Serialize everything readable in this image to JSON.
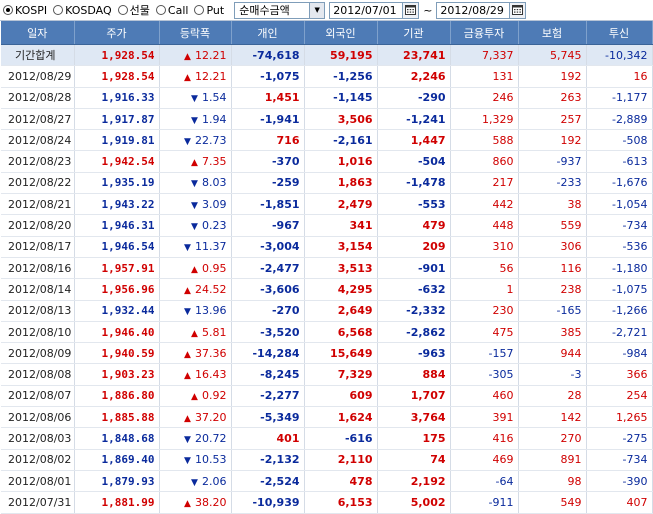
{
  "toolbar": {
    "market_options": [
      {
        "label": "KOSPI",
        "selected": true
      },
      {
        "label": "KOSDAQ",
        "selected": false
      },
      {
        "label": "선물",
        "selected": false
      },
      {
        "label": "Call",
        "selected": false
      },
      {
        "label": "Put",
        "selected": false
      }
    ],
    "metric_select": "순매수금액",
    "start_date": "2012/07/01",
    "separator": "~",
    "end_date": "2012/08/29"
  },
  "columns": [
    "일자",
    "주가",
    "등락폭",
    "개인",
    "외국인",
    "기관",
    "금융투자",
    "보험",
    "투신"
  ],
  "rows": [
    {
      "date": "기간합계",
      "price": "1,928.54",
      "dir": "up",
      "change": "12.21",
      "indiv": "-74,618",
      "foreign": "59,195",
      "inst": "23,741",
      "fin": "7,337",
      "ins": "5,745",
      "trust": "-10,342",
      "sum": true
    },
    {
      "date": "2012/08/29",
      "price": "1,928.54",
      "dir": "up",
      "change": "12.21",
      "indiv": "-1,075",
      "foreign": "-1,256",
      "inst": "2,246",
      "fin": "131",
      "ins": "192",
      "trust": "16"
    },
    {
      "date": "2012/08/28",
      "price": "1,916.33",
      "dir": "dn",
      "change": "1.54",
      "indiv": "1,451",
      "foreign": "-1,145",
      "inst": "-290",
      "fin": "246",
      "ins": "263",
      "trust": "-1,177"
    },
    {
      "date": "2012/08/27",
      "price": "1,917.87",
      "dir": "dn",
      "change": "1.94",
      "indiv": "-1,941",
      "foreign": "3,506",
      "inst": "-1,241",
      "fin": "1,329",
      "ins": "257",
      "trust": "-2,889"
    },
    {
      "date": "2012/08/24",
      "price": "1,919.81",
      "dir": "dn",
      "change": "22.73",
      "indiv": "716",
      "foreign": "-2,161",
      "inst": "1,447",
      "fin": "588",
      "ins": "192",
      "trust": "-508"
    },
    {
      "date": "2012/08/23",
      "price": "1,942.54",
      "dir": "up",
      "change": "7.35",
      "indiv": "-370",
      "foreign": "1,016",
      "inst": "-504",
      "fin": "860",
      "ins": "-937",
      "trust": "-613"
    },
    {
      "date": "2012/08/22",
      "price": "1,935.19",
      "dir": "dn",
      "change": "8.03",
      "indiv": "-259",
      "foreign": "1,863",
      "inst": "-1,478",
      "fin": "217",
      "ins": "-233",
      "trust": "-1,676"
    },
    {
      "date": "2012/08/21",
      "price": "1,943.22",
      "dir": "dn",
      "change": "3.09",
      "indiv": "-1,851",
      "foreign": "2,479",
      "inst": "-553",
      "fin": "442",
      "ins": "38",
      "trust": "-1,054"
    },
    {
      "date": "2012/08/20",
      "price": "1,946.31",
      "dir": "dn",
      "change": "0.23",
      "indiv": "-967",
      "foreign": "341",
      "inst": "479",
      "fin": "448",
      "ins": "559",
      "trust": "-734"
    },
    {
      "date": "2012/08/17",
      "price": "1,946.54",
      "dir": "dn",
      "change": "11.37",
      "indiv": "-3,004",
      "foreign": "3,154",
      "inst": "209",
      "fin": "310",
      "ins": "306",
      "trust": "-536"
    },
    {
      "date": "2012/08/16",
      "price": "1,957.91",
      "dir": "up",
      "change": "0.95",
      "indiv": "-2,477",
      "foreign": "3,513",
      "inst": "-901",
      "fin": "56",
      "ins": "116",
      "trust": "-1,180"
    },
    {
      "date": "2012/08/14",
      "price": "1,956.96",
      "dir": "up",
      "change": "24.52",
      "indiv": "-3,606",
      "foreign": "4,295",
      "inst": "-632",
      "fin": "1",
      "ins": "238",
      "trust": "-1,075"
    },
    {
      "date": "2012/08/13",
      "price": "1,932.44",
      "dir": "dn",
      "change": "13.96",
      "indiv": "-270",
      "foreign": "2,649",
      "inst": "-2,332",
      "fin": "230",
      "ins": "-165",
      "trust": "-1,266"
    },
    {
      "date": "2012/08/10",
      "price": "1,946.40",
      "dir": "up",
      "change": "5.81",
      "indiv": "-3,520",
      "foreign": "6,568",
      "inst": "-2,862",
      "fin": "475",
      "ins": "385",
      "trust": "-2,721"
    },
    {
      "date": "2012/08/09",
      "price": "1,940.59",
      "dir": "up",
      "change": "37.36",
      "indiv": "-14,284",
      "foreign": "15,649",
      "inst": "-963",
      "fin": "-157",
      "ins": "944",
      "trust": "-984"
    },
    {
      "date": "2012/08/08",
      "price": "1,903.23",
      "dir": "up",
      "change": "16.43",
      "indiv": "-8,245",
      "foreign": "7,329",
      "inst": "884",
      "fin": "-305",
      "ins": "-3",
      "trust": "366"
    },
    {
      "date": "2012/08/07",
      "price": "1,886.80",
      "dir": "up",
      "change": "0.92",
      "indiv": "-2,277",
      "foreign": "609",
      "inst": "1,707",
      "fin": "460",
      "ins": "28",
      "trust": "254"
    },
    {
      "date": "2012/08/06",
      "price": "1,885.88",
      "dir": "up",
      "change": "37.20",
      "indiv": "-5,349",
      "foreign": "1,624",
      "inst": "3,764",
      "fin": "391",
      "ins": "142",
      "trust": "1,265"
    },
    {
      "date": "2012/08/03",
      "price": "1,848.68",
      "dir": "dn",
      "change": "20.72",
      "indiv": "401",
      "foreign": "-616",
      "inst": "175",
      "fin": "416",
      "ins": "270",
      "trust": "-275"
    },
    {
      "date": "2012/08/02",
      "price": "1,869.40",
      "dir": "dn",
      "change": "10.53",
      "indiv": "-2,132",
      "foreign": "2,110",
      "inst": "74",
      "fin": "469",
      "ins": "891",
      "trust": "-734"
    },
    {
      "date": "2012/08/01",
      "price": "1,879.93",
      "dir": "dn",
      "change": "2.06",
      "indiv": "-2,524",
      "foreign": "478",
      "inst": "2,192",
      "fin": "-64",
      "ins": "98",
      "trust": "-390"
    },
    {
      "date": "2012/07/31",
      "price": "1,881.99",
      "dir": "up",
      "change": "38.20",
      "indiv": "-10,939",
      "foreign": "6,153",
      "inst": "5,002",
      "fin": "-911",
      "ins": "549",
      "trust": "407"
    }
  ],
  "colors": {
    "header_bg": "#4e7bb6",
    "up": "#d00000",
    "down": "#0a2a9c",
    "sum_bg": "#dfe8f4"
  },
  "icons": {
    "direction_up": "triangle-up-icon",
    "direction_down": "triangle-down-icon",
    "calendar": "calendar-icon",
    "dropdown": "chevron-down-icon"
  }
}
